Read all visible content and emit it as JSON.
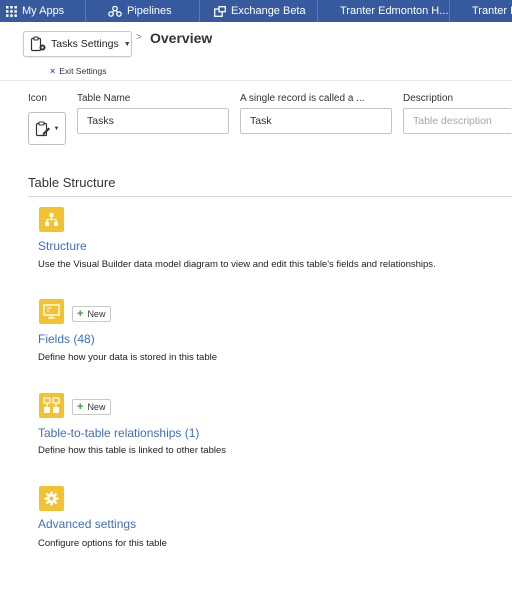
{
  "nav": {
    "items": [
      {
        "label": "My Apps",
        "icon": "grid-icon"
      },
      {
        "label": "Pipelines",
        "icon": "pipeline-icon"
      },
      {
        "label": "Exchange Beta",
        "icon": "exchange-icon"
      },
      {
        "label": "Tranter Edmonton H..."
      },
      {
        "label": "Tranter Ec"
      }
    ]
  },
  "header": {
    "settings_label": "Tasks Settings",
    "breadcrumb_sep": ">",
    "page_title": "Overview",
    "exit_label": "Exit Settings"
  },
  "form": {
    "icon_label": "Icon",
    "table_name_label": "Table Name",
    "table_name_value": "Tasks",
    "record_label": "A single record is called a ...",
    "record_value": "Task",
    "description_label": "Description",
    "description_placeholder": "Table description"
  },
  "structure": {
    "title": "Table Structure",
    "items": [
      {
        "label": "Structure",
        "desc": "Use the Visual Builder data model diagram to view and edit this table's fields and relationships.",
        "icon": "structure-icon"
      },
      {
        "label": "Fields (48)",
        "desc": "Define how your data is stored in this table",
        "icon": "fields-icon",
        "new_label": "New"
      },
      {
        "label": "Table-to-table relationships (1)",
        "desc": "Define how this table is linked to other tables",
        "icon": "relationships-icon",
        "new_label": "New"
      },
      {
        "label": "Advanced settings",
        "desc": "Configure options for this table",
        "icon": "gear-icon"
      }
    ]
  },
  "colors": {
    "nav_bg": "#375a9e",
    "accent": "#3a6fc4",
    "tile": "#f2c230"
  }
}
